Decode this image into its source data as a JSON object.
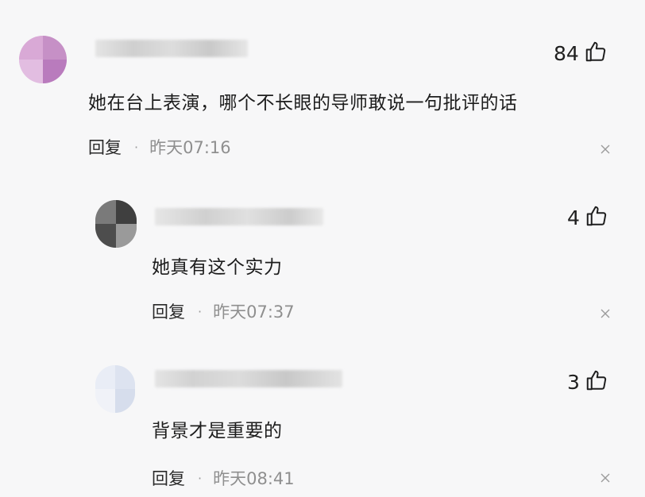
{
  "comments": [
    {
      "text": "她在台上表演，哪个不长眼的导师敢说一句批评的话",
      "reply_label": "回复",
      "separator": "·",
      "time": "昨天07:16",
      "likes": "84",
      "avatar_colors": [
        "#d9a9d6",
        "#c17ec0",
        "#e7c5e6",
        "#b46ab8"
      ]
    },
    {
      "text": "她真有这个实力",
      "reply_label": "回复",
      "separator": "·",
      "time": "昨天07:37",
      "likes": "4",
      "avatar_colors": [
        "#a8a8a8",
        "#5f5f5f",
        "#3b3b3b",
        "#8c8c8c"
      ]
    },
    {
      "text": "背景才是重要的",
      "reply_label": "回复",
      "separator": "·",
      "time": "昨天08:41",
      "likes": "3",
      "avatar_colors": [
        "#e9edf6",
        "#dfe5f2",
        "#f1f3f9",
        "#d8dfee"
      ]
    }
  ],
  "icons": {
    "like": "thumbs-up-icon",
    "close": "close-icon"
  }
}
